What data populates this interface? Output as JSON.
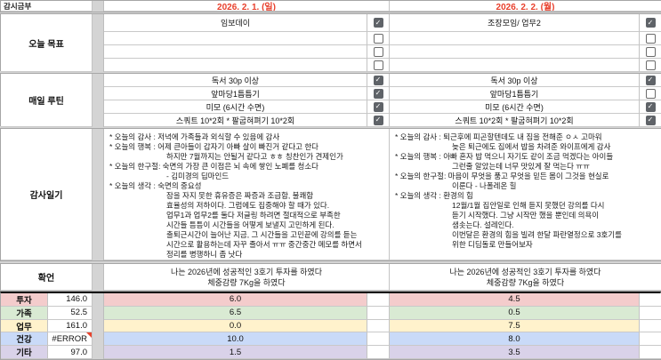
{
  "corner_label": "감시금부",
  "dates": {
    "day1": "2026. 2. 1. (일)",
    "day2": "2026. 2. 2. (월)",
    "color": "#e8402d"
  },
  "labels": {
    "goals": "오늘 목표",
    "routine": "매일 루틴",
    "diary": "감사일기",
    "affirmation": "확언"
  },
  "goal_rows": [
    {
      "day1": {
        "t": "임보데이",
        "c": true
      },
      "day2": {
        "t": "조장모임/ 업무2",
        "c": true
      }
    },
    {
      "day1": {
        "t": "",
        "c": false
      },
      "day2": {
        "t": "",
        "c": false
      }
    },
    {
      "day1": {
        "t": "",
        "c": false
      },
      "day2": {
        "t": "",
        "c": false
      }
    },
    {
      "day1": {
        "t": "",
        "c": false
      },
      "day2": {
        "t": "",
        "c": false
      }
    }
  ],
  "routine_rows": [
    {
      "day1": {
        "t": "독서 30p 이상",
        "c": true
      },
      "day2": {
        "t": "독서 30p 이상",
        "c": true
      }
    },
    {
      "day1": {
        "t": "앞마당1틈틈기",
        "c": true
      },
      "day2": {
        "t": "앞마당1틈틈기",
        "c": false
      }
    },
    {
      "day1": {
        "t": "미모 (6시간 수면)",
        "c": true
      },
      "day2": {
        "t": "미모 (6시간 수면)",
        "c": true
      }
    },
    {
      "day1": {
        "t": "스쿼트 10*2회 * 팔굽혀펴기 10*2회",
        "c": true
      },
      "day2": {
        "t": "스쿼트 10*2회 * 팔굽혀펴기 10*2회",
        "c": true
      }
    }
  ],
  "diary": {
    "day1_lines": [
      {
        "ind": false,
        "t": "* 오늘의 감사 : 저녁에 가족들과 외식할 수 있음에 감사"
      },
      {
        "ind": false,
        "t": "* 오늘의 행복 : 어제 큰아들이 갑자기 아빠 살이 빠진거 같다고 한다"
      },
      {
        "ind": true,
        "t": "하지만 7월까지는 안될거 같다고 ㅎㅎ 칭찬인가 견제인가"
      },
      {
        "ind": false,
        "t": "* 오늘의 한구절: 숙면의 가장 큰 이점은 뇌 속에 쌓인 노폐를 청소다"
      },
      {
        "ind": true,
        "t": "- 김미경의 딥마인드"
      },
      {
        "ind": false,
        "t": "* 오늘의 생각 : 숙면의 중요성"
      },
      {
        "ind": true,
        "t": "잠을 자지 못한 휴유증은 짜증과 조급함, 불쾌함"
      },
      {
        "ind": true,
        "t": "효율성의 저하이다. 그럼에도 집중해야 할 때가 있다."
      },
      {
        "ind": true,
        "t": "업무1과 업무2를 둘다 저글링 하려면 절대적으로 부족한"
      },
      {
        "ind": true,
        "t": "시간들 틈틈이 시간들을 어떻게 보낼지 고민하게 된다."
      },
      {
        "ind": true,
        "t": "출퇴근시간이 늘어난 지금, 그 시간들을 고민끝에 강의를 듣는"
      },
      {
        "ind": true,
        "t": "시간으로 활용하는데 자꾸 졸아서 ㅠㅠ 중간중간 메모를 하면서"
      },
      {
        "ind": true,
        "t": "정리를 병행하니 좀 낫다"
      }
    ],
    "day2_lines": [
      {
        "ind": false,
        "t": "* 오늘의 감사 : 퇴근후에 피곤할텐데도 내 짐을 전해준 ㅇㅅ 고마워"
      },
      {
        "ind": true,
        "t": "늦은 퇴근에도 집에서 밥을 차려준 와이프에게 감사"
      },
      {
        "ind": false,
        "t": "* 오늘의 행복 : 아빠 혼자 밥 먹으니 자기도 같이 조금 먹겠다는 아이들"
      },
      {
        "ind": true,
        "t": "그런줄 알았는데 너무 맛있게 잘 먹는다 ㅠㅠ"
      },
      {
        "ind": false,
        "t": "* 오늘의 한구절: 마음이 무엇을 품고 무엇을 믿든 몸이 그것을 현실로"
      },
      {
        "ind": true,
        "t": "이룬다  - 나폴레온 힐"
      },
      {
        "ind": false,
        "t": "* 오늘의 생각 : 환경의 힘"
      },
      {
        "ind": true,
        "t": "12월/1월 집안일로 인해 듣지 못했던 강의를 다시"
      },
      {
        "ind": true,
        "t": "듣기 시작했다. 그냥 시작만 했을 뿐인데 의욕이"
      },
      {
        "ind": true,
        "t": "샘솟는다. 설레인다."
      },
      {
        "ind": true,
        "t": "이번달은 환경의 힘을 빌려 한달 파란열정으로 3호기를"
      },
      {
        "ind": true,
        "t": "위한 디딤돌로 만들어보자"
      }
    ]
  },
  "affirmation": {
    "day1": "나는 2026년에 성공적인 3호기 투자를 하였다\n체중감량 7Kg을 하였다",
    "day2": "나는 2026년에 성공적인 3호기 투자를 하였다\n체중감량 7Kg을 하였다"
  },
  "score_rows": [
    {
      "label": "투자",
      "total": "146.0",
      "day1": "6.0",
      "day2": "4.5",
      "color": "#f4cccc"
    },
    {
      "label": "가족",
      "total": "52.5",
      "day1": "6.5",
      "day2": "0.5",
      "color": "#d9ead3"
    },
    {
      "label": "업무",
      "total": "161.0",
      "day1": "0.0",
      "day2": "7.5",
      "color": "#fff2cc"
    },
    {
      "label": "건강",
      "total": "#ERROR",
      "day1": "10.0",
      "day2": "8.0",
      "color": "#c9daf8",
      "error": true
    },
    {
      "label": "기타",
      "total": "97.0",
      "day1": "1.5",
      "day2": "3.5",
      "color": "#d9d2e9"
    }
  ]
}
